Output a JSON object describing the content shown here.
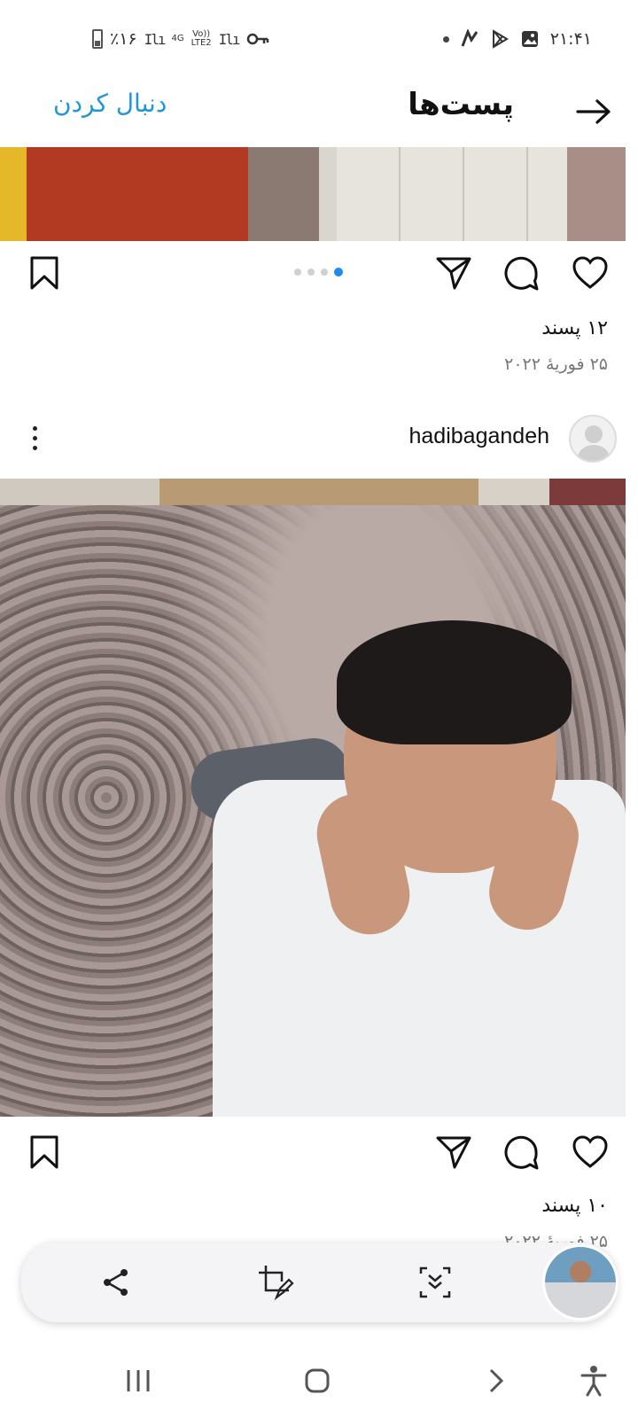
{
  "status_bar": {
    "battery": "٪۱۶",
    "network_1": "4G",
    "network_2": "Vo))\nLTE2",
    "time": "۲۱:۴۱"
  },
  "header": {
    "title": "پست‌ها",
    "follow_label": "دنبال کردن"
  },
  "post_previous": {
    "likes": "۱۲ پسند",
    "date": "۲۵ فوریهٔ ۲۰۲۲",
    "carousel": {
      "count": 4,
      "active_index": 3
    }
  },
  "post_current": {
    "username": "hadibagandeh",
    "likes": "۱۰ پسند",
    "date": "۲۵ فوریهٔ ۲۰۲۲"
  },
  "icons": {
    "back": "arrow-right-icon",
    "like": "heart-icon",
    "comment": "comment-icon",
    "share": "send-icon",
    "save": "bookmark-icon",
    "more": "more-vertical-icon",
    "toolbar_share": "share-icon",
    "toolbar_edit": "crop-edit-icon",
    "toolbar_scroll": "scroll-capture-icon",
    "nav_recents": "recents-icon",
    "nav_home": "home-icon",
    "nav_back": "back-icon",
    "nav_accessibility": "accessibility-icon"
  },
  "colors": {
    "accent": "#2196d6",
    "carousel_active": "#1a8cf0"
  }
}
